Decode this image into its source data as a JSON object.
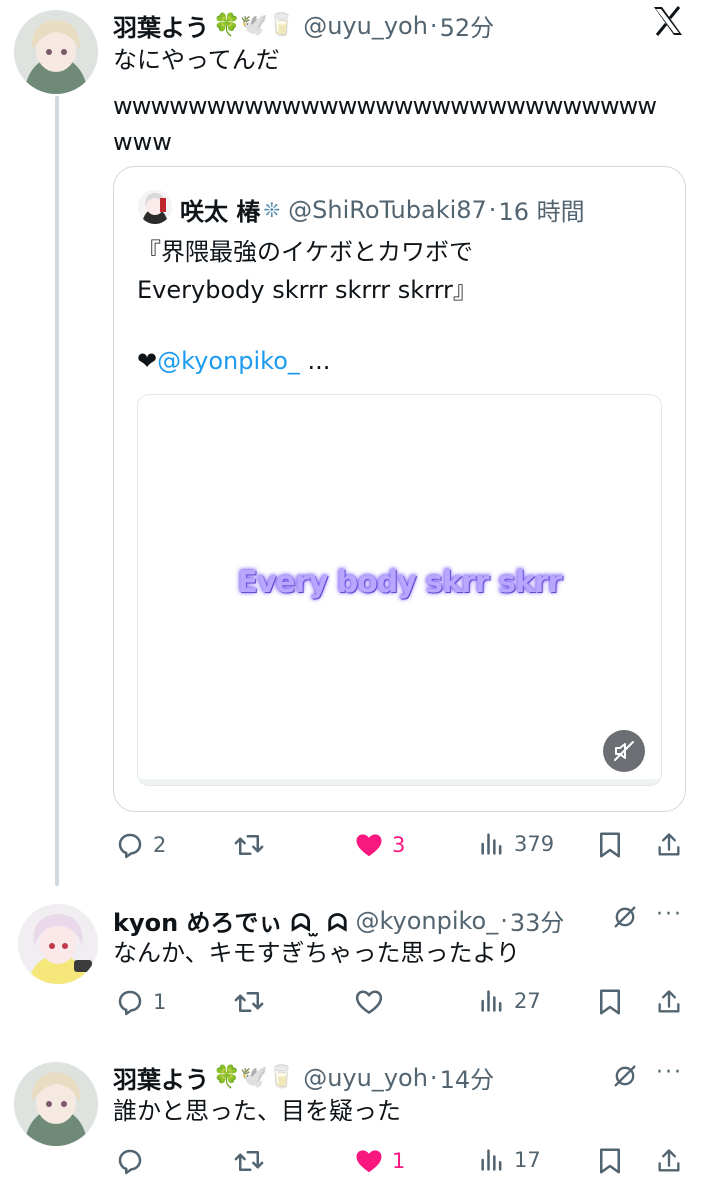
{
  "tweet1": {
    "name": "羽葉よう",
    "emojis": "🍀🕊️🥛",
    "handle": "@uyu_yoh",
    "sep": "·",
    "time": "52分",
    "text_line1": "なにやってんだ",
    "text_line2": "wwwwwwwwwwwwwwwwwwwwwwwwwwwww",
    "text_line3": "www",
    "quote": {
      "name": "咲太 椿",
      "emoji": "❊",
      "handle": "@ShiRoTubaki87",
      "sep": "·",
      "time": "16 時間",
      "line1": "『界隈最強のイケボとカワボで",
      "line2": "Everybody skrrr skrrr skrrr』",
      "heart": "❤",
      "mention": "@kyonpiko_",
      "ellipsis": "...",
      "video_text": "Every body skrr skrr"
    },
    "actions": {
      "replies": "2",
      "likes": "3",
      "views": "379"
    }
  },
  "tweet2": {
    "name": "kyon めろでぃ ᗣ ̫ ᗣ",
    "handle": "@kyonpiko_",
    "sep": "·",
    "time": "33分",
    "text": "なんか、キモすぎちゃった思ったより",
    "actions": {
      "replies": "1",
      "views": "27"
    }
  },
  "tweet3": {
    "name": "羽葉よう",
    "emojis": "🍀🕊️🥛",
    "handle": "@uyu_yoh",
    "sep": "·",
    "time": "14分",
    "text": "誰かと思った、目を疑った",
    "actions": {
      "likes": "1",
      "views": "17"
    }
  },
  "colors": {
    "like": "#f91880",
    "mention": "#1d9bf0",
    "muted": "#536471",
    "border": "#cfd9de"
  }
}
